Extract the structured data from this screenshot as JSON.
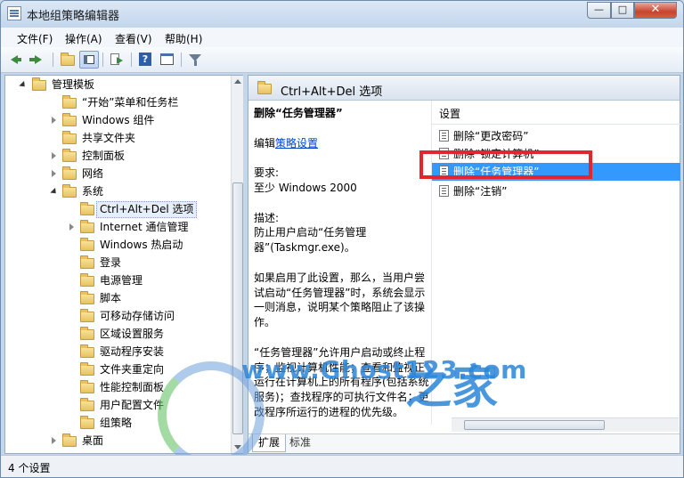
{
  "window": {
    "title": "本地组策略编辑器",
    "min": "—",
    "max": "□",
    "close": "✕"
  },
  "menu": [
    "文件(F)",
    "操作(A)",
    "查看(V)",
    "帮助(H)"
  ],
  "toolbar": {
    "icons": [
      "back-icon",
      "forward-icon",
      "up-folder-icon",
      "show-hide-tree-icon",
      "export-list-icon",
      "help-icon",
      "properties-icon",
      "filter-icon"
    ]
  },
  "tree": [
    {
      "label": "管理模板",
      "level": 0,
      "expanded": true
    },
    {
      "label": "“开始”菜单和任务栏",
      "level": 1,
      "expanded": null
    },
    {
      "label": "Windows 组件",
      "level": 1,
      "expanded": false
    },
    {
      "label": "共享文件夹",
      "level": 1,
      "expanded": null
    },
    {
      "label": "控制面板",
      "level": 1,
      "expanded": false
    },
    {
      "label": "网络",
      "level": 1,
      "expanded": false
    },
    {
      "label": "系统",
      "level": 1,
      "expanded": true
    },
    {
      "label": "Ctrl+Alt+Del 选项",
      "level": 2,
      "expanded": null,
      "selected": true
    },
    {
      "label": "Internet 通信管理",
      "level": 2,
      "expanded": false
    },
    {
      "label": "Windows 热启动",
      "level": 2,
      "expanded": null
    },
    {
      "label": "登录",
      "level": 2,
      "expanded": null
    },
    {
      "label": "电源管理",
      "level": 2,
      "expanded": null
    },
    {
      "label": "脚本",
      "level": 2,
      "expanded": null
    },
    {
      "label": "可移动存储访问",
      "level": 2,
      "expanded": null
    },
    {
      "label": "区域设置服务",
      "level": 2,
      "expanded": null
    },
    {
      "label": "驱动程序安装",
      "level": 2,
      "expanded": null
    },
    {
      "label": "文件夹重定向",
      "level": 2,
      "expanded": null
    },
    {
      "label": "性能控制面板",
      "level": 2,
      "expanded": null
    },
    {
      "label": "用户配置文件",
      "level": 2,
      "expanded": null
    },
    {
      "label": "组策略",
      "level": 2,
      "expanded": null
    },
    {
      "label": "桌面",
      "level": 1,
      "expanded": false
    }
  ],
  "right": {
    "header": "Ctrl+Alt+Del 选项",
    "desc": {
      "title": "删除“任务管理器”",
      "edit_prefix": "编辑",
      "edit_link": "策略设置",
      "req_label": "要求:",
      "req_value": "至少 Windows 2000",
      "desc_label": "描述:",
      "desc_text": "防止用户启动“任务管理器”(Taskmgr.exe)。",
      "para1": "如果启用了此设置，那么，当用户尝试启动“任务管理器”时，系统会显示一则消息，说明某个策略阻止了该操作。",
      "para2": "“任务管理器”允许用户启动或终止程序；监视计算机性能；查看和监视正运行在计算机上的所有程序(包括系统服务)；查找程序的可执行文件名；更改程序所运行的进程的优先级。"
    },
    "list_header": "设置",
    "items": [
      {
        "label": "删除“更改密码”",
        "selected": false
      },
      {
        "label": "删除“锁定计算机”",
        "selected": false
      },
      {
        "label": "删除“任务管理器”",
        "selected": true
      },
      {
        "label": "删除“注销”",
        "selected": false
      }
    ],
    "tabs": [
      "扩展",
      "标准"
    ]
  },
  "status": "4 个设置",
  "watermark": {
    "site": "www.Ghost123.com",
    "cjk": "之家"
  }
}
